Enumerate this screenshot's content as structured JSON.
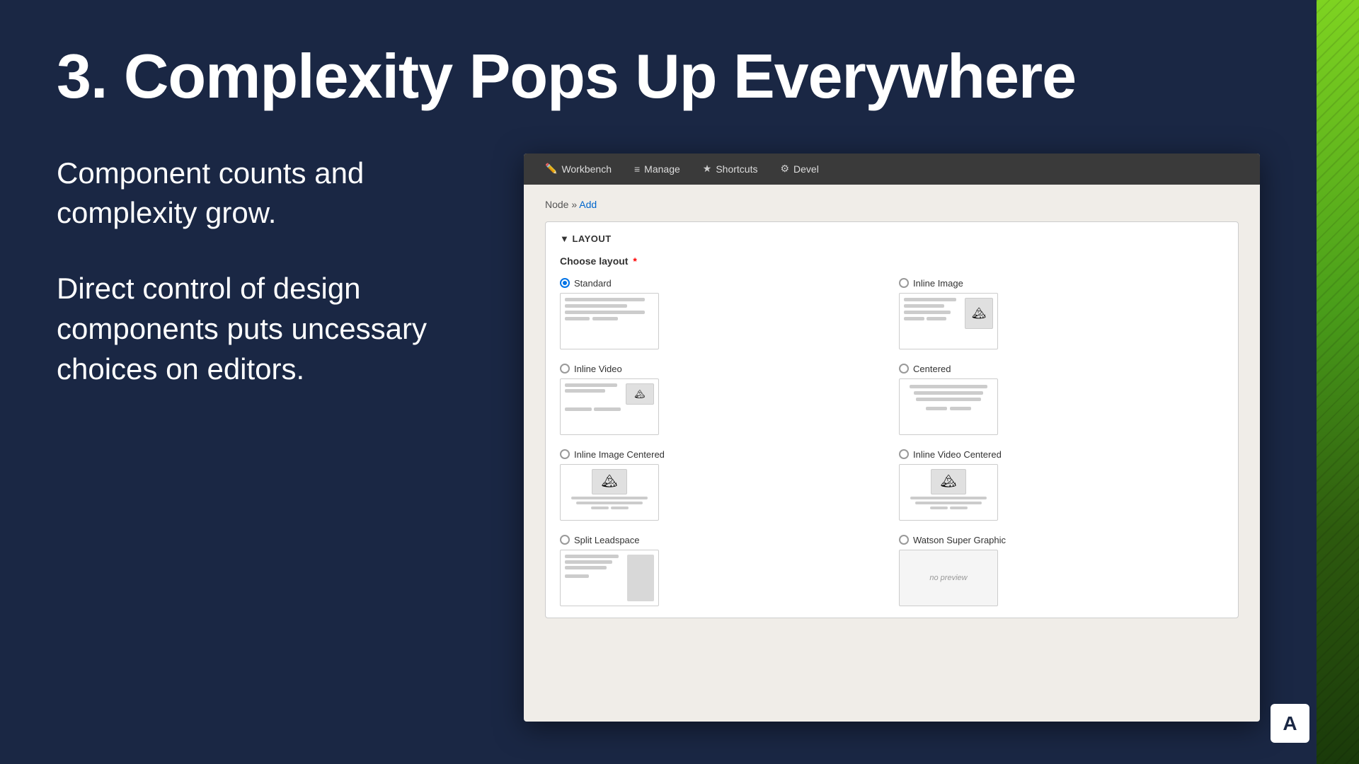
{
  "slide": {
    "title": "3. Complexity Pops Up Everywhere",
    "body_p1": "Component counts and complexity grow.",
    "body_p2": "Direct control of design components puts uncessary choices on editors."
  },
  "toolbar": {
    "workbench_label": "Workbench",
    "manage_label": "Manage",
    "shortcuts_label": "Shortcuts",
    "devel_label": "Devel"
  },
  "breadcrumb": {
    "node": "Node",
    "separator": " » ",
    "add": "Add"
  },
  "layout_section": {
    "header": "▼ LAYOUT",
    "choose_label": "Choose layout",
    "required_star": "*"
  },
  "layout_options": [
    {
      "id": "standard",
      "label": "Standard",
      "selected": true,
      "type": "standard"
    },
    {
      "id": "inline-image",
      "label": "Inline Image",
      "selected": false,
      "type": "inline-image"
    },
    {
      "id": "inline-video",
      "label": "Inline Video",
      "selected": false,
      "type": "inline-video"
    },
    {
      "id": "centered",
      "label": "Centered",
      "selected": false,
      "type": "centered"
    },
    {
      "id": "inline-image-centered",
      "label": "Inline Image Centered",
      "selected": false,
      "type": "inline-image-centered"
    },
    {
      "id": "inline-video-centered",
      "label": "Inline Video Centered",
      "selected": false,
      "type": "inline-video-centered"
    },
    {
      "id": "split-leadspace",
      "label": "Split Leadspace",
      "selected": false,
      "type": "split"
    },
    {
      "id": "watson-super-graphic",
      "label": "Watson Super Graphic",
      "selected": false,
      "type": "no-preview"
    }
  ],
  "logo": "A",
  "no_preview_text": "no preview"
}
